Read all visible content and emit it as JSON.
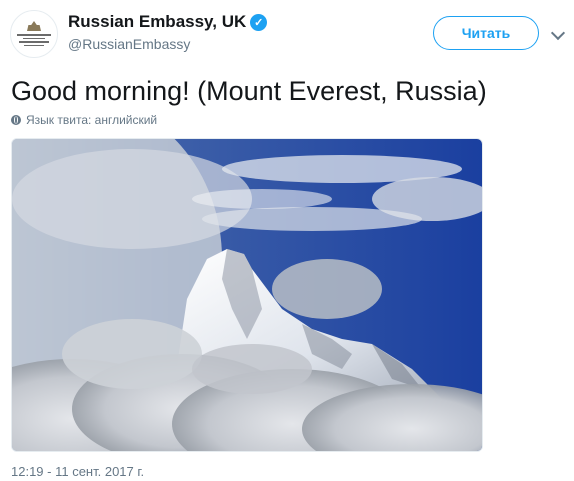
{
  "author": {
    "display_name": "Russian Embassy, UK",
    "handle": "@RussianEmbassy",
    "verified": true,
    "avatar_icon": "embassy-emblem-icon"
  },
  "follow_button": {
    "label": "Читать",
    "color": "#1da1f2"
  },
  "menu_icon": "chevron-down-icon",
  "tweet": {
    "text": "Good morning! (Mount Everest, Russia)",
    "language_label": "Язык твита: английский",
    "language_icon": "globe-icon"
  },
  "media": {
    "type": "photo",
    "subject": "snow-covered mountain peak among clouds under blue sky"
  },
  "timestamp": "12:19 - 11 сент. 2017 г.",
  "colors": {
    "text": "#14171a",
    "secondary": "#657786",
    "accent": "#1da1f2"
  }
}
